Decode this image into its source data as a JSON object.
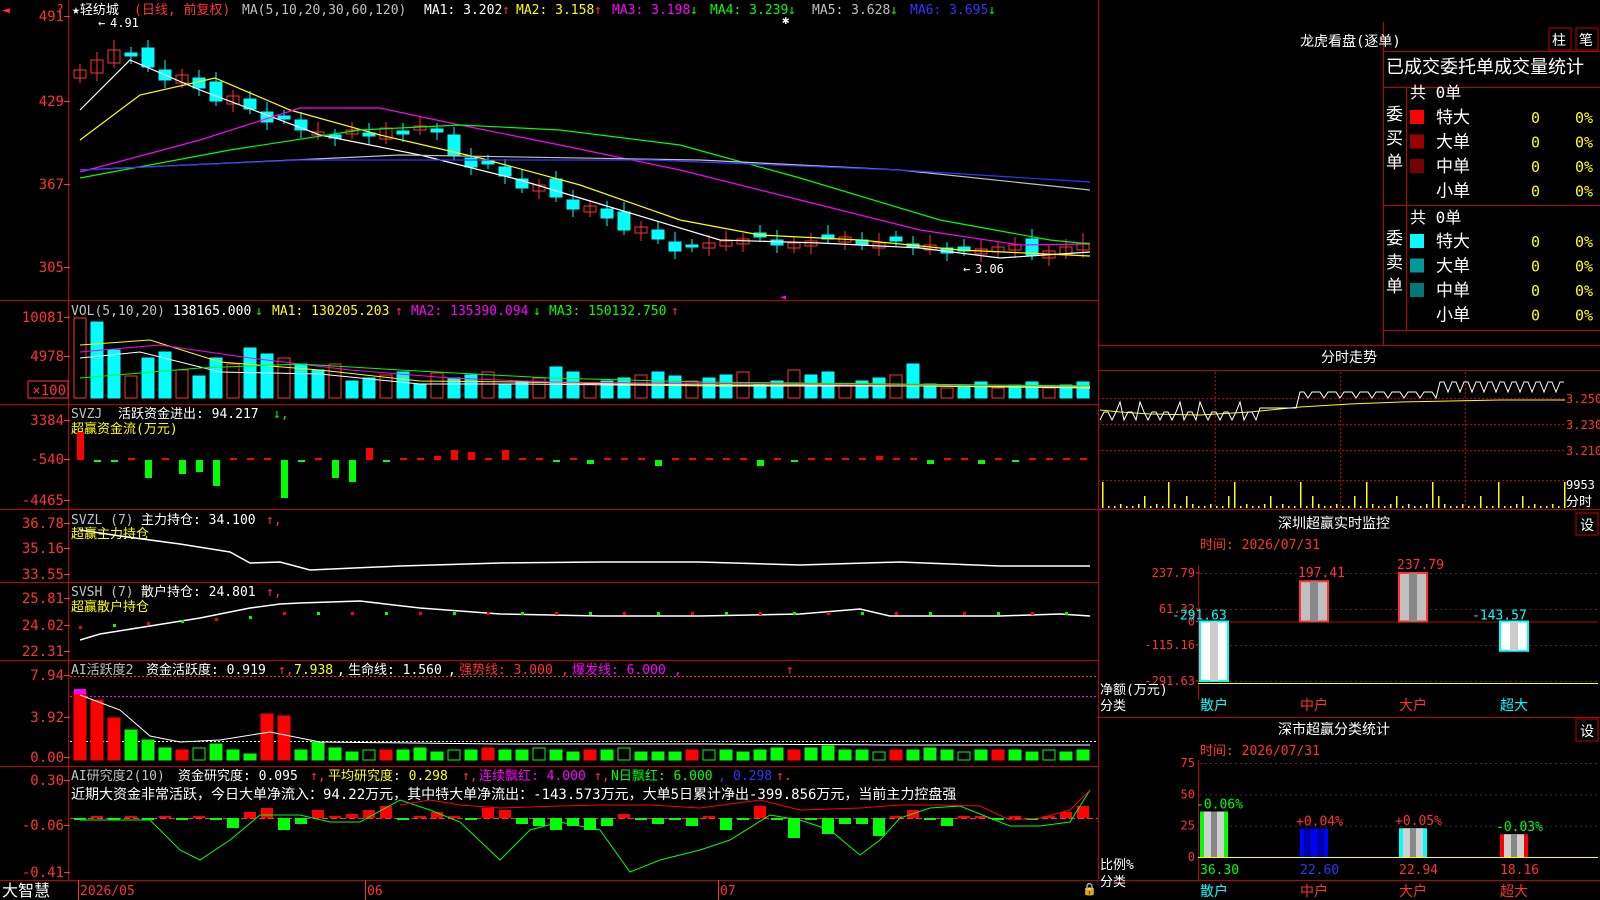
{
  "stock_name": "★轻纺城",
  "period": "(日线, 前复权)",
  "ma_params": "MA(5,10,20,30,60,120)",
  "ma_items": [
    {
      "label": "MA1: 3.202",
      "arrow": "↑",
      "color": "#ffffff"
    },
    {
      "label": "MA2: 3.158",
      "arrow": "↑",
      "color": "#ffff00"
    },
    {
      "label": "MA3: 3.198",
      "arrow": "↓",
      "color": "#ff00ff"
    },
    {
      "label": "MA4: 3.239",
      "arrow": "↓",
      "color": "#00ff00"
    },
    {
      "label": "MA5: 3.628",
      "arrow": "↓",
      "color": "#c0c0c0"
    },
    {
      "label": "MA6: 3.695",
      "arrow": "↓",
      "color": "#3333ff"
    }
  ],
  "price_high": "4.91",
  "price_low": "3.06",
  "price_axis": [
    "491",
    "429",
    "367",
    "305"
  ],
  "vol": {
    "name": "VOL(5,10,20)",
    "value": "138165.000",
    "ma1": "MA1: 130205.203",
    "ma2": "MA2: 135390.094",
    "ma3": "MA3: 150132.750",
    "axis": [
      "10081",
      "4978",
      "×100"
    ]
  },
  "svzj": {
    "name": "SVZJ",
    "label": "活跃资金进出: 94.217",
    "sub": "超赢资金流(万元)",
    "axis": [
      "3384",
      "-540",
      "-4465"
    ]
  },
  "svzl": {
    "name": "SVZL (7)",
    "label": "主力持仓: 34.100",
    "sub": "超赢主力持仓",
    "axis": [
      "36.78",
      "35.16",
      "33.55"
    ]
  },
  "svsh": {
    "name": "SVSH (7)",
    "label": "散户持仓: 24.801",
    "sub": "超赢散户持仓",
    "axis": [
      "25.81",
      "24.02",
      "22.31"
    ]
  },
  "ai1": {
    "name": "AI活跃度2",
    "label": "资金活跃度: 0.919",
    "v2": "7.938",
    "life": "生命线: 1.560",
    "strong": "强势线: 3.000",
    "burst": "爆发线: 6.000",
    "axis": [
      "7.94",
      "3.92",
      "0.00"
    ]
  },
  "ai2": {
    "name": "AI研究度2(10)",
    "label": "资金研究度: 0.095",
    "avg": "平均研究度: 0.298",
    "cont": "连续飘红: 4.000",
    "nday": "N日飘红: 6.000",
    "last": "0.298",
    "axis": [
      "0.30",
      "-0.06",
      "-0.41"
    ]
  },
  "commentary": "近期大资金非常活跃，今日大单净流入：94.22万元，其中特大单净流出：-143.573万元，大单5日累计净出-399.856万元，当前主力控盘强",
  "bottom_dates": [
    "2026/05",
    "06",
    "07"
  ],
  "logo": "大智慧",
  "right": {
    "dragon_title": "龙虎看盘(逐单)",
    "btn1": "柱",
    "btn2": "笔",
    "stats_title": "已成交委托单成交量统计",
    "buy_count": "共 0单",
    "buy_label": "委买单",
    "sell_count": "共 0单",
    "sell_label": "委卖单",
    "buy_rows": [
      {
        "name": "特大",
        "val": "0",
        "pct": "0%",
        "color": "#ff0000"
      },
      {
        "name": "大单",
        "val": "0",
        "pct": "0%",
        "color": "#990000"
      },
      {
        "name": "中单",
        "val": "0",
        "pct": "0%",
        "color": "#770000"
      },
      {
        "name": "小单",
        "val": "0",
        "pct": "0%",
        "color": ""
      }
    ],
    "sell_rows": [
      {
        "name": "特大",
        "val": "0",
        "pct": "0%",
        "color": "#00ffff"
      },
      {
        "name": "大单",
        "val": "0",
        "pct": "0%",
        "color": "#009999"
      },
      {
        "name": "中单",
        "val": "0",
        "pct": "0%",
        "color": "#007777"
      },
      {
        "name": "小单",
        "val": "0",
        "pct": "0%",
        "color": ""
      }
    ],
    "intraday_title": "分时走势",
    "intraday_axis": [
      "3.250",
      "3.230",
      "3.210"
    ],
    "intraday_vol": "9953",
    "intraday_vol_label": "分时",
    "monitor_title": "深圳超赢实时监控",
    "monitor_time": "时间: 2026/07/31",
    "set_label": "设",
    "monitor_axis": [
      "237.79",
      "61.32",
      "0",
      "-115.16",
      "-291.63"
    ],
    "monitor_unit": "净额(万元)",
    "monitor_cat_label": "分类",
    "classify_title": "深市超赢分类统计",
    "classify_time": "时间: 2026/07/31",
    "classify_axis": [
      "75",
      "50",
      "25",
      "0"
    ],
    "classify_unit": "比例%",
    "classify_cat_label": "分类"
  },
  "chart_data": [
    {
      "type": "bar",
      "title": "深圳超赢实时监控",
      "categories": [
        "散户",
        "中户",
        "大户",
        "超大"
      ],
      "values": [
        -291.63,
        197.41,
        237.79,
        -143.57
      ],
      "ylabel": "净额(万元)",
      "ylim": [
        -291.63,
        237.79
      ]
    },
    {
      "type": "bar",
      "title": "深市超赢分类统计",
      "categories": [
        "散户",
        "中户",
        "大户",
        "超大"
      ],
      "values": [
        36.3,
        22.6,
        22.94,
        18.16
      ],
      "changes": [
        "-0.06%",
        "+0.04%",
        "+0.05%",
        "-0.03%"
      ],
      "ylabel": "比例%",
      "ylim": [
        0,
        75
      ]
    }
  ]
}
